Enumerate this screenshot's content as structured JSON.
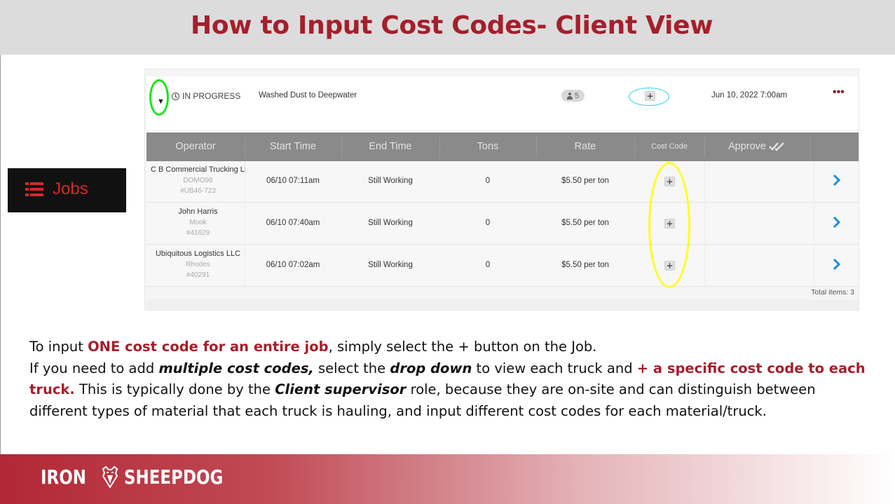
{
  "slide": {
    "title": "How to Input Cost Codes- Client View"
  },
  "sidebar_tile": {
    "label": "Jobs",
    "icon": "list-icon"
  },
  "job": {
    "status": "IN PROGRESS",
    "name": "Washed Dust to Deepwater",
    "truck_count": "5",
    "datetime": "Jun 10, 2022 7:00am",
    "menu_icon": "ellipsis-icon"
  },
  "table": {
    "headers": {
      "operator": "Operator",
      "start_time": "Start Time",
      "end_time": "End Time",
      "tons": "Tons",
      "rate": "Rate",
      "cost_code": "Cost Code",
      "approve": "Approve"
    },
    "rows": [
      {
        "operator": "C B Commercial Trucking LLC",
        "truck": "DOMO98",
        "id": "#UB46-723",
        "start": "06/10 07:11am",
        "end": "Still Working",
        "tons": "0",
        "rate": "$5.50 per ton"
      },
      {
        "operator": "John Harris",
        "truck": "Mook",
        "id": "#41629",
        "start": "06/10 07:40am",
        "end": "Still Working",
        "tons": "0",
        "rate": "$5.50 per ton"
      },
      {
        "operator": "Ubiquitous Logistics LLC",
        "truck": "Rhodes",
        "id": "#40291",
        "start": "06/10 07:02am",
        "end": "Still Working",
        "tons": "0",
        "rate": "$5.50 per ton"
      }
    ],
    "total": "Total items: 3"
  },
  "instructions": {
    "p1_a": "To input ",
    "p1_b": "ONE cost code for an entire job",
    "p1_c": ", simply select the + button on the Job.",
    "p2_a": "If you need to add ",
    "p2_b": "multiple cost codes,",
    "p2_c": " select the ",
    "p2_d": "drop down",
    "p2_e": " to view each truck and ",
    "p2_f": "+ a specific cost code to each truck.",
    "p2_g": " This is typically done by the ",
    "p2_h": "Client supervisor",
    "p2_i": " role, because they are on-site and can distinguish between different types of material that each truck is hauling, and input different cost codes for each material/truck."
  },
  "footer": {
    "brand_left": "IRON",
    "brand_right": "SHEEPDOG"
  },
  "colors": {
    "title_red": "#a51f2b",
    "highlight_green": "#19e619",
    "highlight_yellow": "#ffff1a",
    "highlight_cyan": "#20d4e8",
    "chevron_blue": "#1a8ed8"
  }
}
